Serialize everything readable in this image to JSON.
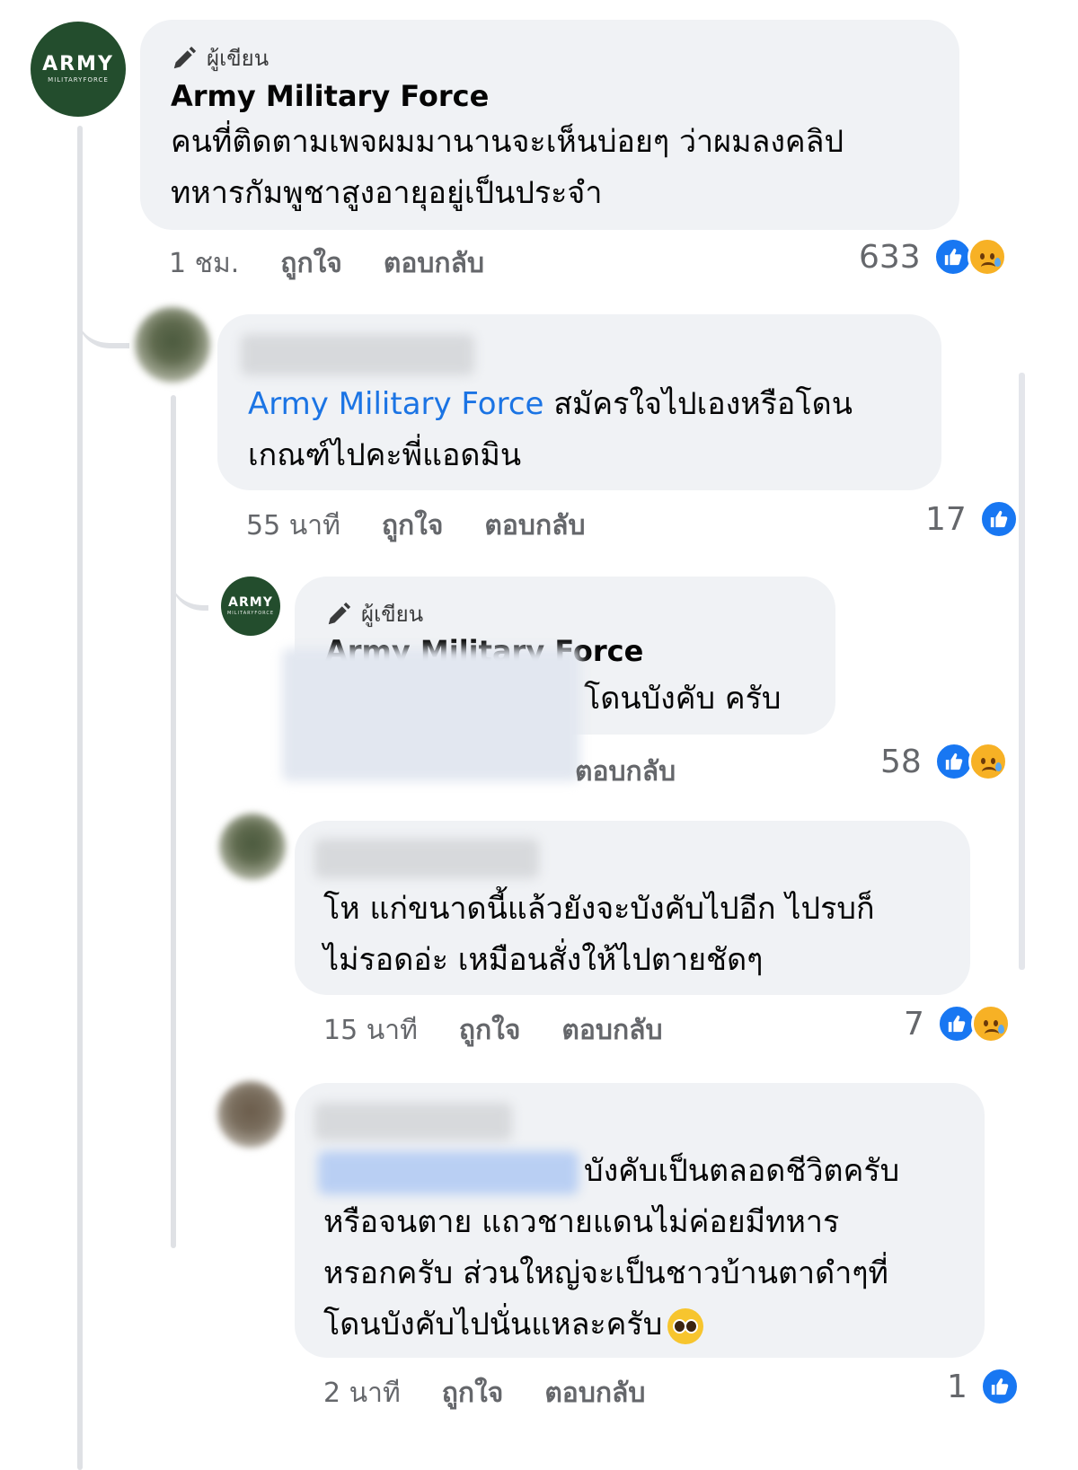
{
  "comments": [
    {
      "badge": "ผู้เขียน",
      "name": "Army Military Force",
      "text_lines": [
        "คนที่ติดตามเพจผมมานานจะเห็นบ่อยๆ ว่าผมลงคลิป",
        "ทหารกัมพูชาสูงอายุอยู่เป็นประจำ"
      ],
      "time": "1 ชม.",
      "like_label": "ถูกใจ",
      "reply_label": "ตอบกลับ",
      "reaction_count": "633",
      "reactions": [
        "like-icon",
        "sad-icon"
      ]
    },
    {
      "mention": "Army Military Force",
      "text_first": " สมัครใจไปเองหรือโดน",
      "text_second": "เกณฑ์ไปคะพี่แอดมิน",
      "time": "55 นาที",
      "like_label": "ถูกใจ",
      "reply_label": "ตอบกลับ",
      "reaction_count": "17",
      "reactions": [
        "like-icon"
      ]
    },
    {
      "badge": "ผู้เขียน",
      "name": "Army Military Force",
      "text": "โดนบังคับ ครับ",
      "reply_label": "ตอบกลับ",
      "reaction_count": "58",
      "reactions": [
        "like-icon",
        "sad-icon"
      ]
    },
    {
      "text_lines": [
        "โห แก่ขนาดนี้แล้วยังจะบังคับไปอีก ไปรบก็",
        "ไม่รอดอ่ะ เหมือนสั่งให้ไปตายชัดๆ"
      ],
      "time": "15 นาที",
      "like_label": "ถูกใจ",
      "reply_label": "ตอบกลับ",
      "reaction_count": "7",
      "reactions": [
        "like-icon",
        "sad-icon"
      ]
    },
    {
      "text_first": "บังคับเป็นตลอดชีวิตครับ",
      "text_lines": [
        "หรือจนตาย แถวชายแดนไม่ค่อยมีทหาร",
        "หรอกครับ ส่วนใหญ่จะเป็นชาวบ้านตาดำๆที่",
        "โดนบังคับไปนั่นแหละครับ"
      ],
      "time": "2 นาที",
      "like_label": "ถูกใจ",
      "reply_label": "ตอบกลับ",
      "reaction_count": "1",
      "reactions": [
        "like-icon"
      ]
    }
  ],
  "page_avatar": {
    "word": "ARMY",
    "sub": "MILITARYFORCE"
  },
  "colors": {
    "like": "#1877f2",
    "sad": "#f7b125",
    "mention": "#1b74e4",
    "bubble": "#f0f2f5",
    "avatar": "#234d2d"
  }
}
